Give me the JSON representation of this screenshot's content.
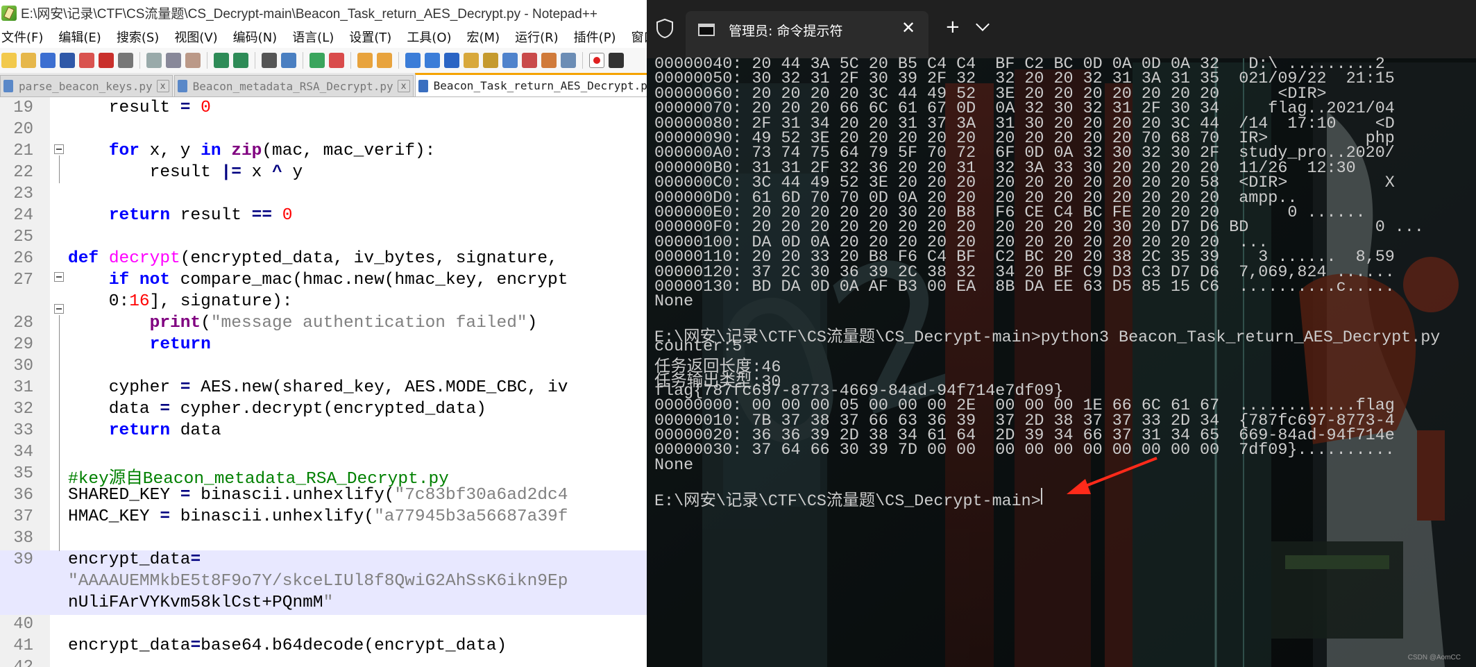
{
  "notepad": {
    "title": "E:\\网安\\记录\\CTF\\CS流量题\\CS_Decrypt-main\\Beacon_Task_return_AES_Decrypt.py - Notepad++",
    "menu": [
      "文件(F)",
      "编辑(E)",
      "搜索(S)",
      "视图(V)",
      "编码(N)",
      "语言(L)",
      "设置(T)",
      "工具(O)",
      "宏(M)",
      "运行(R)",
      "插件(P)",
      "窗口("
    ],
    "tabs": [
      {
        "label": "parse_beacon_keys.py",
        "active": false
      },
      {
        "label": "Beacon_metadata_RSA_Decrypt.py",
        "active": false
      },
      {
        "label": "Beacon_Task_return_AES_Decrypt.py",
        "active": true
      }
    ],
    "tab_close_glyph": "x",
    "lines": [
      {
        "n": "19",
        "code": "    result = 0"
      },
      {
        "n": "20",
        "code": ""
      },
      {
        "n": "21",
        "code": "    for x, y in zip(mac, mac_verif):"
      },
      {
        "n": "22",
        "code": "        result |= x ^ y"
      },
      {
        "n": "23",
        "code": ""
      },
      {
        "n": "24",
        "code": "    return result == 0"
      },
      {
        "n": "25",
        "code": ""
      },
      {
        "n": "26",
        "code": "def decrypt(encrypted_data, iv_bytes, signature,"
      },
      {
        "n": "27",
        "code": "    if not compare_mac(hmac.new(hmac_key, encrypt"
      },
      {
        "n": "",
        "code": "    0:16], signature):"
      },
      {
        "n": "28",
        "code": "        print(\"message authentication failed\")"
      },
      {
        "n": "29",
        "code": "        return"
      },
      {
        "n": "30",
        "code": ""
      },
      {
        "n": "31",
        "code": "    cypher = AES.new(shared_key, AES.MODE_CBC, iv"
      },
      {
        "n": "32",
        "code": "    data = cypher.decrypt(encrypted_data)"
      },
      {
        "n": "33",
        "code": "    return data"
      },
      {
        "n": "34",
        "code": ""
      },
      {
        "n": "35",
        "code": "#key源自Beacon_metadata_RSA_Decrypt.py"
      },
      {
        "n": "36",
        "code": "SHARED_KEY = binascii.unhexlify(\"7c83bf30a6ad2dc4"
      },
      {
        "n": "37",
        "code": "HMAC_KEY = binascii.unhexlify(\"a77945b3a56687a39f"
      },
      {
        "n": "38",
        "code": ""
      },
      {
        "n": "39",
        "code": "encrypt_data="
      },
      {
        "n": "",
        "code": "\"AAAAUEMMkbE5t8F9o7Y/skceLIUl8f8QwiG2AhSsK6ikn9Ep"
      },
      {
        "n": "",
        "code": "nUliFArVYKvm58klCst+PQnmM\""
      },
      {
        "n": "40",
        "code": ""
      },
      {
        "n": "41",
        "code": "encrypt_data=base64.b64decode(encrypt_data)"
      },
      {
        "n": "42",
        "code": ""
      }
    ]
  },
  "terminal": {
    "tab_title": "管理员: 命令提示符",
    "close_glyph": "✕",
    "new_tab_glyph": "+",
    "lines": [
      "00000040: 20 44 3A 5C 20 B5 C4 C4  BF C2 BC 0D 0A 0D 0A 32   D:\\ .........2",
      "00000050: 30 32 31 2F 30 39 2F 32  32 20 20 32 31 3A 31 35  021/09/22  21:15",
      "00000060: 20 20 20 20 3C 44 49 52  3E 20 20 20 20 20 20 20      <DIR>",
      "00000070: 20 20 20 66 6C 61 67 0D  0A 32 30 32 31 2F 30 34     flag..2021/04",
      "00000080: 2F 31 34 20 20 31 37 3A  31 30 20 20 20 20 3C 44  /14  17:10    <D",
      "00000090: 49 52 3E 20 20 20 20 20  20 20 20 20 20 70 68 70  IR>          php",
      "000000A0: 73 74 75 64 79 5F 70 72  6F 0D 0A 32 30 32 30 2F  study_pro..2020/",
      "000000B0: 31 31 2F 32 36 20 20 31  32 3A 33 30 20 20 20 20  11/26  12:30",
      "000000C0: 3C 44 49 52 3E 20 20 20  20 20 20 20 20 20 20 58  <DIR>          X",
      "000000D0: 61 6D 70 70 0D 0A 20 20  20 20 20 20 20 20 20 20  ampp..",
      "000000E0: 20 20 20 20 20 30 20 B8  F6 CE C4 BC FE 20 20 20       0 ......",
      "000000F0: 20 20 20 20 20 20 20 20  20 20 20 20 30 20 D7 D6 BD             0 ...",
      "00000100: DA 0D 0A 20 20 20 20 20  20 20 20 20 20 20 20 20  ...",
      "00000110: 20 20 33 20 B8 F6 C4 BF  C2 BC 20 20 38 2C 35 39    3 ......  8,59",
      "00000120: 37 2C 30 36 39 2C 38 32  34 20 BF C9 D3 C3 D7 D6  7,069,824 ......",
      "00000130: BD DA 0D 0A AF B3 00 EA  8B DA EE 63 D5 85 15 C6  ..........c.....",
      "None",
      "",
      "E:\\网安\\记录\\CTF\\CS流量题\\CS_Decrypt-main>python3 Beacon_Task_return_AES_Decrypt.py",
      "counter:5",
      "任务返回长度:46",
      "任务输出类型:30",
      "flag{787fc697-8773-4669-84ad-94f714e7df09}",
      "00000000: 00 00 00 05 00 00 00 2E  00 00 00 1E 66 6C 61 67  ............flag",
      "00000010: 7B 37 38 37 66 63 36 39  37 2D 38 37 37 33 2D 34  {787fc697-8773-4",
      "00000020: 36 36 39 2D 38 34 61 64  2D 39 34 66 37 31 34 65  669-84ad-94f714e",
      "00000030: 37 64 66 30 39 7D 00 00  00 00 00 00 00 00 00 00  7df09}..........",
      "None",
      "",
      "E:\\网安\\记录\\CTF\\CS流量题\\CS_Decrypt-main>"
    ],
    "watermark": "CSDN @AomCC"
  },
  "colors": {
    "keyword": "#0000ff",
    "builtin": "#800080",
    "function_name": "#ff00ff",
    "number": "#ff0000",
    "string": "#808080",
    "comment": "#008000",
    "terminal_text": "#cccccc",
    "arrow": "#ff2a1a",
    "tab_accent": "#f5a300"
  },
  "icons": [
    "notepadpp-icon",
    "shield-icon",
    "cmd-icon",
    "close-icon",
    "plus-icon",
    "chevron-down-icon",
    "red-arrow-annotation"
  ]
}
